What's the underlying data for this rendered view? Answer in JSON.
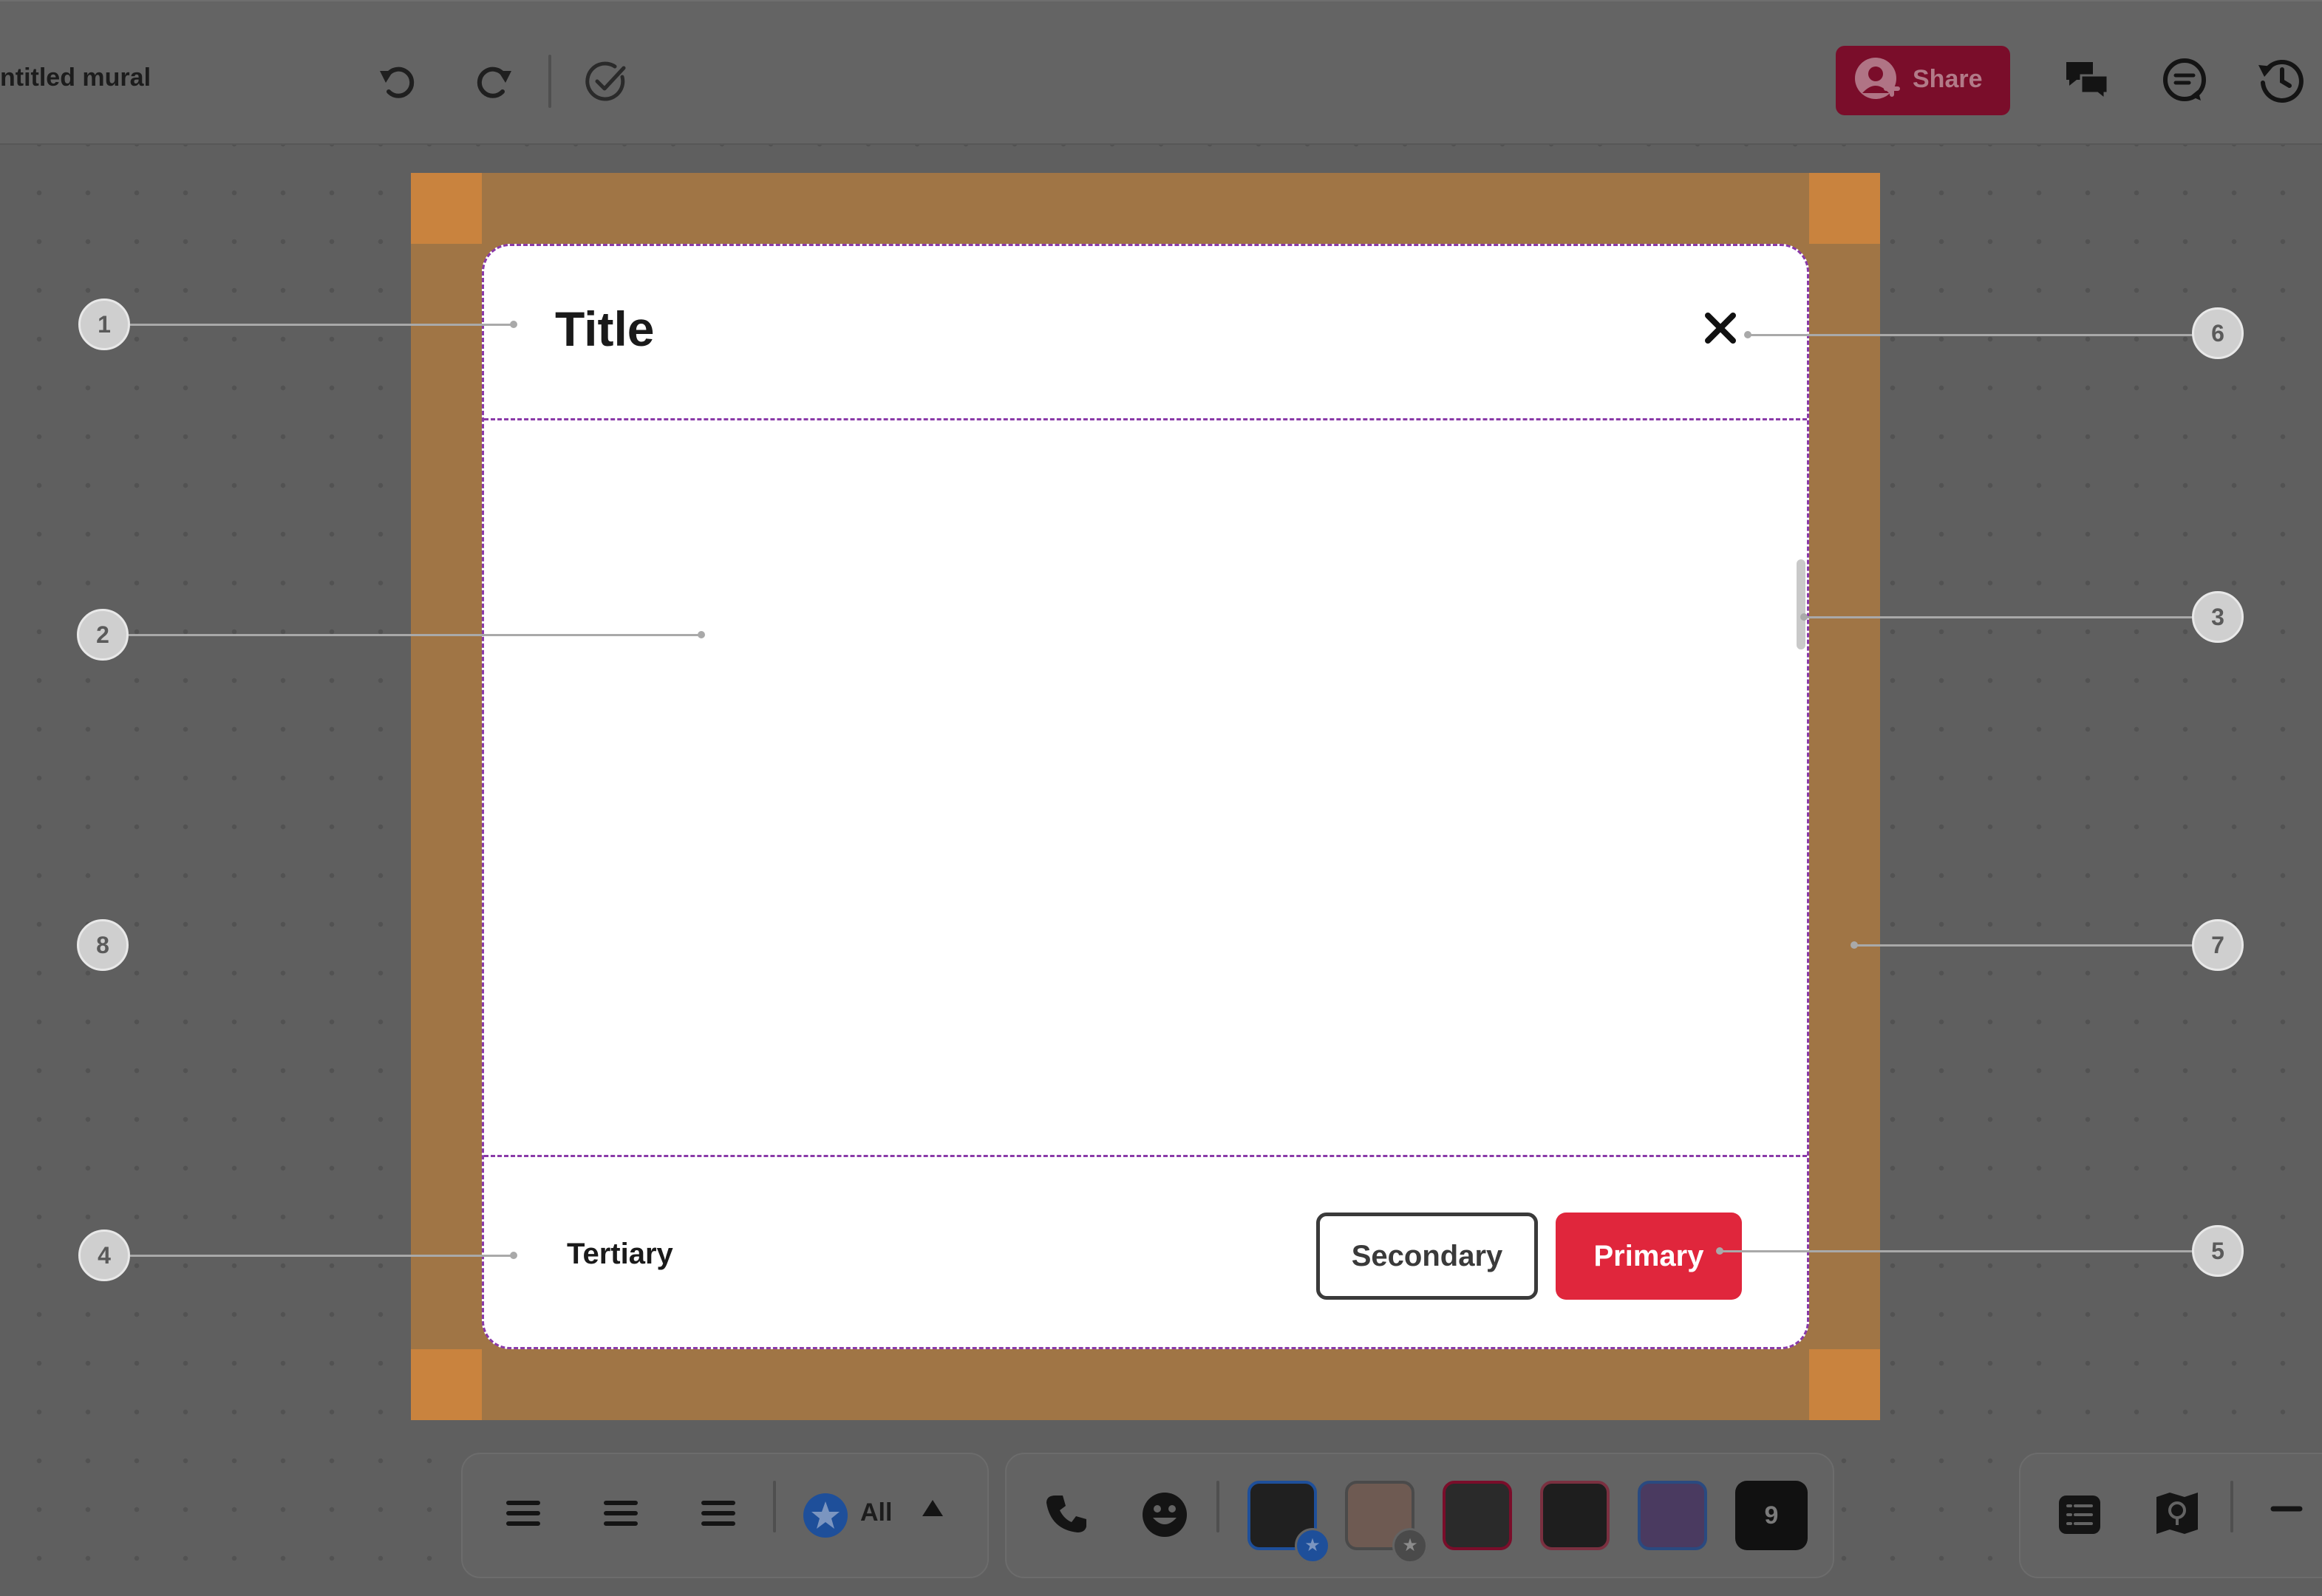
{
  "topbar": {
    "mural_title": "ntitled mural",
    "undo_icon": "undo-icon",
    "redo_icon": "redo-icon",
    "check_icon": "check-circle-icon",
    "share_label": "Share",
    "share_color": "#7a0d2a",
    "chat_icon": "chat-bubbles-icon",
    "comment_icon": "comment-icon",
    "history_icon": "history-icon"
  },
  "dialog": {
    "title": "Title",
    "close_icon": "close-icon",
    "tertiary_label": "Tertiary",
    "secondary_label": "Secondary",
    "primary_label": "Primary",
    "primary_color": "#e0263c"
  },
  "callouts": [
    "1",
    "2",
    "3",
    "4",
    "5",
    "6",
    "7",
    "8"
  ],
  "bottombar": {
    "filter_label": "All",
    "collaborator_count": "9",
    "icons": [
      "align-left-icon",
      "align-center-icon",
      "align-right-icon",
      "star-icon",
      "caret-up-icon",
      "phone-icon",
      "smiley-icon",
      "outline-icon",
      "map-icon",
      "minus-icon"
    ]
  }
}
